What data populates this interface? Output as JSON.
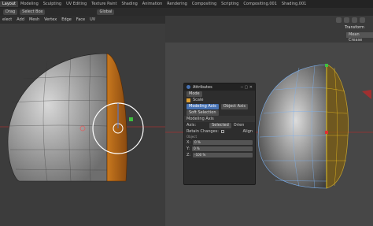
{
  "tabs": [
    "Layout",
    "Modeling",
    "Sculpting",
    "UV Editing",
    "Texture Paint",
    "Shading",
    "Animation",
    "Rendering",
    "Compositing",
    "Scripting",
    "Compositing.001",
    "Shading.001"
  ],
  "header": {
    "mode": "Drag",
    "select": "Select Box",
    "orientation": "Global"
  },
  "menus": [
    "elect",
    "Add",
    "Mesh",
    "Vertex",
    "Edge",
    "Face",
    "UV"
  ],
  "sidebar": {
    "transform": "Transform",
    "mean": "Mean Crease"
  },
  "panel": {
    "title": "Attributes",
    "mode": "Mode",
    "scale": "Scale",
    "tab1": "Modeling Axis",
    "tab2": "Object Axis",
    "soft": "Soft Selection",
    "section": "Modeling Axis",
    "axis_label": "Axis:",
    "axis_value": "Selected",
    "orien": "Orien",
    "retain": "Retain Changes:",
    "align": "Align",
    "object": "Object",
    "x": "X:",
    "xv": "0 %",
    "y": "Y:",
    "yv": "0 %",
    "z": "Z:",
    "zv": "-100 %"
  },
  "colors": {
    "accent": "#4772b3",
    "mesh_orange": "#e0a030",
    "mesh_blue": "#6aa0e0"
  }
}
